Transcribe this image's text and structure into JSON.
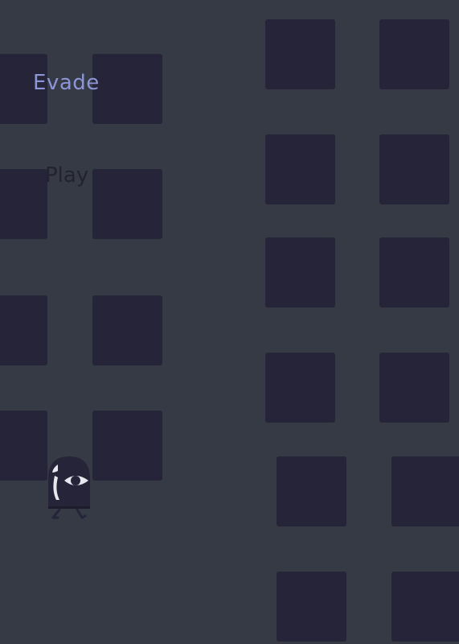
{
  "game": {
    "title": "Evade",
    "play_label": "Play"
  },
  "colors": {
    "background": "#363A44",
    "block": "#262438",
    "title": "#8C95D8",
    "play_text": "#23222F",
    "player_eye": "#E8E8F0"
  },
  "player": {
    "icon": "ghost-eye-icon"
  }
}
